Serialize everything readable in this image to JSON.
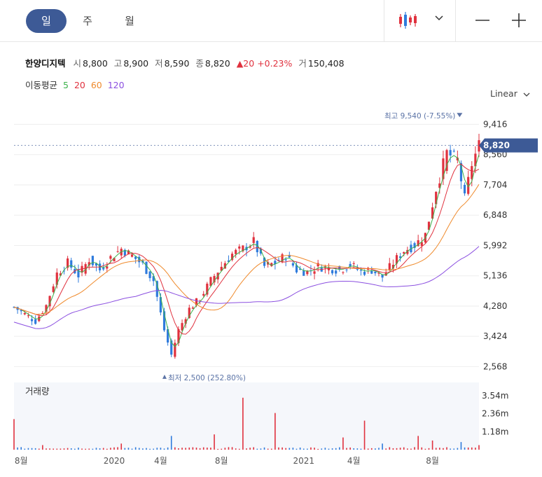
{
  "tabs": [
    {
      "label": "일",
      "active": true
    },
    {
      "label": "주",
      "active": false
    },
    {
      "label": "월",
      "active": false
    }
  ],
  "toolbar": {
    "chart_type_icon": "candlestick-icon",
    "dropdown_icon": "chevron-down-icon",
    "zoom_out_icon": "minus-icon",
    "zoom_in_icon": "plus-icon"
  },
  "quote": {
    "name": "한양디지텍",
    "open_label": "시",
    "open": "8,800",
    "high_label": "고",
    "high": "8,900",
    "low_label": "저",
    "low": "8,590",
    "close_label": "종",
    "close": "8,820",
    "change": "▲20",
    "change_pct": "+0.23%",
    "volume_label": "거",
    "volume": "150,408"
  },
  "moving_average": {
    "label": "이동평균",
    "periods": [
      {
        "label": "5",
        "color": "#3bb24a"
      },
      {
        "label": "20",
        "color": "#e0313e"
      },
      {
        "label": "60",
        "color": "#ef8a2c"
      },
      {
        "label": "120",
        "color": "#8b4fe0"
      }
    ]
  },
  "scale_mode": "Linear",
  "colors": {
    "up": "#e0313e",
    "down": "#2f7bdc",
    "accent": "#3d5a96",
    "annotation": "#5b73a6"
  },
  "chart_data": {
    "type": "candlestick",
    "y_ticks": [
      "9,416",
      "8,560",
      "7,704",
      "6,848",
      "5,992",
      "5,136",
      "4,280",
      "3,424",
      "2,568"
    ],
    "ylim": [
      2240,
      9960
    ],
    "x_ticks": [
      "8월",
      "2020",
      "4월",
      "8월",
      "2021",
      "4월",
      "8월"
    ],
    "last_price_label": "8,820",
    "high_annotation": "최고 9,540 (-7.55%)",
    "low_annotation": "최저 2,500 (252.80%)",
    "price_series": [
      {
        "x": 0,
        "close": 4250
      },
      {
        "x": 3,
        "close": 4050
      },
      {
        "x": 6,
        "close": 3850
      },
      {
        "x": 9,
        "close": 4300
      },
      {
        "x": 12,
        "close": 5200
      },
      {
        "x": 15,
        "close": 5500
      },
      {
        "x": 18,
        "close": 5150
      },
      {
        "x": 21,
        "close": 5600
      },
      {
        "x": 24,
        "close": 5300
      },
      {
        "x": 27,
        "close": 5650
      },
      {
        "x": 30,
        "close": 5900
      },
      {
        "x": 33,
        "close": 5700
      },
      {
        "x": 36,
        "close": 5450
      },
      {
        "x": 39,
        "close": 5000
      },
      {
        "x": 42,
        "close": 3600
      },
      {
        "x": 44,
        "close": 2900
      },
      {
        "x": 46,
        "close": 3600
      },
      {
        "x": 49,
        "close": 4200
      },
      {
        "x": 52,
        "close": 4500
      },
      {
        "x": 55,
        "close": 5000
      },
      {
        "x": 58,
        "close": 5400
      },
      {
        "x": 61,
        "close": 5750
      },
      {
        "x": 64,
        "close": 5900
      },
      {
        "x": 67,
        "close": 6100
      },
      {
        "x": 70,
        "close": 5400
      },
      {
        "x": 73,
        "close": 5500
      },
      {
        "x": 76,
        "close": 5700
      },
      {
        "x": 79,
        "close": 5300
      },
      {
        "x": 82,
        "close": 5250
      },
      {
        "x": 85,
        "close": 5400
      },
      {
        "x": 88,
        "close": 5350
      },
      {
        "x": 91,
        "close": 5300
      },
      {
        "x": 94,
        "close": 5450
      },
      {
        "x": 97,
        "close": 5250
      },
      {
        "x": 100,
        "close": 5300
      },
      {
        "x": 103,
        "close": 5100
      },
      {
        "x": 106,
        "close": 5500
      },
      {
        "x": 109,
        "close": 5850
      },
      {
        "x": 112,
        "close": 6000
      },
      {
        "x": 115,
        "close": 6300
      },
      {
        "x": 118,
        "close": 7600
      },
      {
        "x": 121,
        "close": 8600
      },
      {
        "x": 124,
        "close": 8400
      },
      {
        "x": 126,
        "close": 7300
      },
      {
        "x": 128,
        "close": 8300
      },
      {
        "x": 130,
        "close": 8820
      }
    ],
    "volume_ticks": [
      "3.54m",
      "2.36m",
      "1.18m"
    ],
    "volume_ylim": [
      0,
      4.4
    ],
    "volume_series": [
      {
        "x": 0,
        "value": 2.0
      },
      {
        "x": 8,
        "value": 0.3
      },
      {
        "x": 30,
        "value": 0.4
      },
      {
        "x": 44,
        "value": 0.9
      },
      {
        "x": 56,
        "value": 1.0
      },
      {
        "x": 64,
        "value": 3.4
      },
      {
        "x": 73,
        "value": 2.4
      },
      {
        "x": 92,
        "value": 0.8
      },
      {
        "x": 98,
        "value": 1.9
      },
      {
        "x": 103,
        "value": 0.4
      },
      {
        "x": 113,
        "value": 0.9
      },
      {
        "x": 117,
        "value": 0.6
      },
      {
        "x": 125,
        "value": 0.5
      },
      {
        "x": 130,
        "value": 0.3
      }
    ]
  }
}
